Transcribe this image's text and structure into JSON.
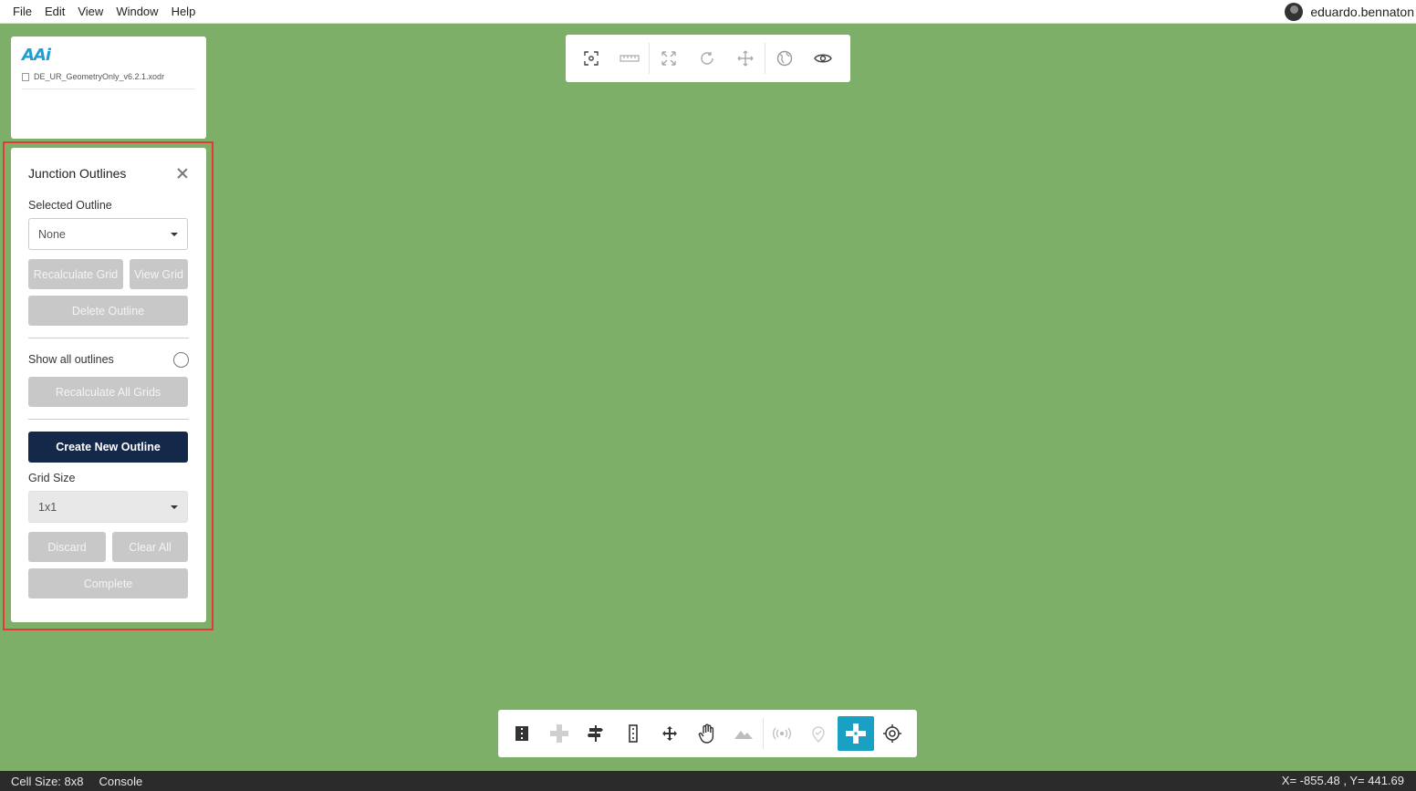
{
  "menubar": {
    "items": [
      "File",
      "Edit",
      "View",
      "Window",
      "Help"
    ],
    "user_name": "eduardo.bennaton"
  },
  "file_card": {
    "logo": "AAi",
    "file_name": "DE_UR_GeometryOnly_v6.2.1.xodr"
  },
  "panel": {
    "title": "Junction Outlines",
    "selected_outline_label": "Selected Outline",
    "selected_outline_value": "None",
    "recalculate_grid": "Recalculate Grid",
    "view_grid": "View Grid",
    "delete_outline": "Delete Outline",
    "show_all_outlines": "Show all outlines",
    "recalculate_all_grids": "Recalculate All Grids",
    "create_new_outline": "Create New Outline",
    "grid_size_label": "Grid Size",
    "grid_size_value": "1x1",
    "discard": "Discard",
    "clear_all": "Clear All",
    "complete": "Complete"
  },
  "top_toolbar": {
    "icons": [
      "focus-icon",
      "ruler-icon",
      "fit-view-icon",
      "rotate-icon",
      "move-icon",
      "globe-icon",
      "eye-icon"
    ]
  },
  "bottom_toolbar": {
    "icons": [
      "road-icon",
      "junction-icon",
      "signpost-icon",
      "lane-icon",
      "pan-move-icon",
      "hand-icon",
      "terrain-icon",
      "signal-icon",
      "marker-icon",
      "junction-outline-icon",
      "target-icon"
    ],
    "active": "junction-outline-icon",
    "accent_color": "#1aa0c2"
  },
  "statusbar": {
    "cell_size": "Cell Size: 8x8",
    "console": "Console",
    "coords": "X= -855.48 , Y= 441.69"
  },
  "colors": {
    "canvas": "#7daf69",
    "primary_button": "#14284a",
    "highlight": "#e53935"
  }
}
